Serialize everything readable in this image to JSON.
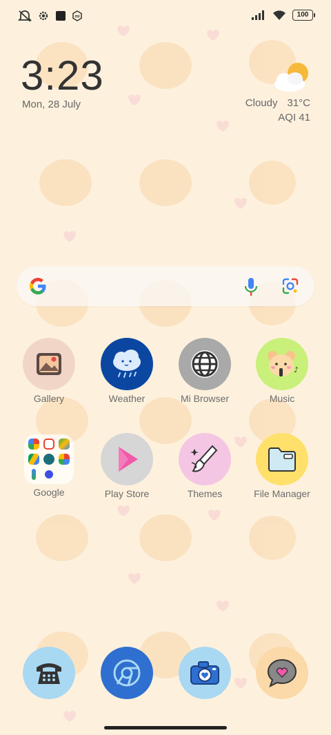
{
  "status_bar": {
    "battery": "100",
    "left_icons": [
      "mute-vibrate-icon",
      "gear-icon",
      "square-icon",
      "mi-icon"
    ],
    "right_icons": [
      "signal-icon",
      "wifi-icon",
      "battery-icon"
    ]
  },
  "clock_widget": {
    "time": "3:23",
    "date": "Mon, 28 July"
  },
  "weather_widget": {
    "condition": "Cloudy",
    "temperature": "31°C",
    "aqi": "AQI 41"
  },
  "search_bar": {
    "icons": [
      "google-logo",
      "mic-icon",
      "lens-icon"
    ]
  },
  "apps_row1": [
    {
      "label": "Gallery"
    },
    {
      "label": "Weather"
    },
    {
      "label": "Mi Browser"
    },
    {
      "label": "Music"
    }
  ],
  "apps_row2": [
    {
      "label": "Google"
    },
    {
      "label": "Play Store"
    },
    {
      "label": "Themes"
    },
    {
      "label": "File Manager"
    }
  ],
  "dock": [
    {
      "icon": "phone-icon"
    },
    {
      "icon": "chrome-icon"
    },
    {
      "icon": "camera-icon"
    },
    {
      "icon": "messages-icon"
    }
  ],
  "colors": {
    "background": "#FDF1DE",
    "weather_icon_bg": "#0B47A1",
    "music_icon_bg": "#C9F07A",
    "files_icon_bg": "#FFE06B",
    "themes_icon_bg": "#F4C6E3"
  }
}
